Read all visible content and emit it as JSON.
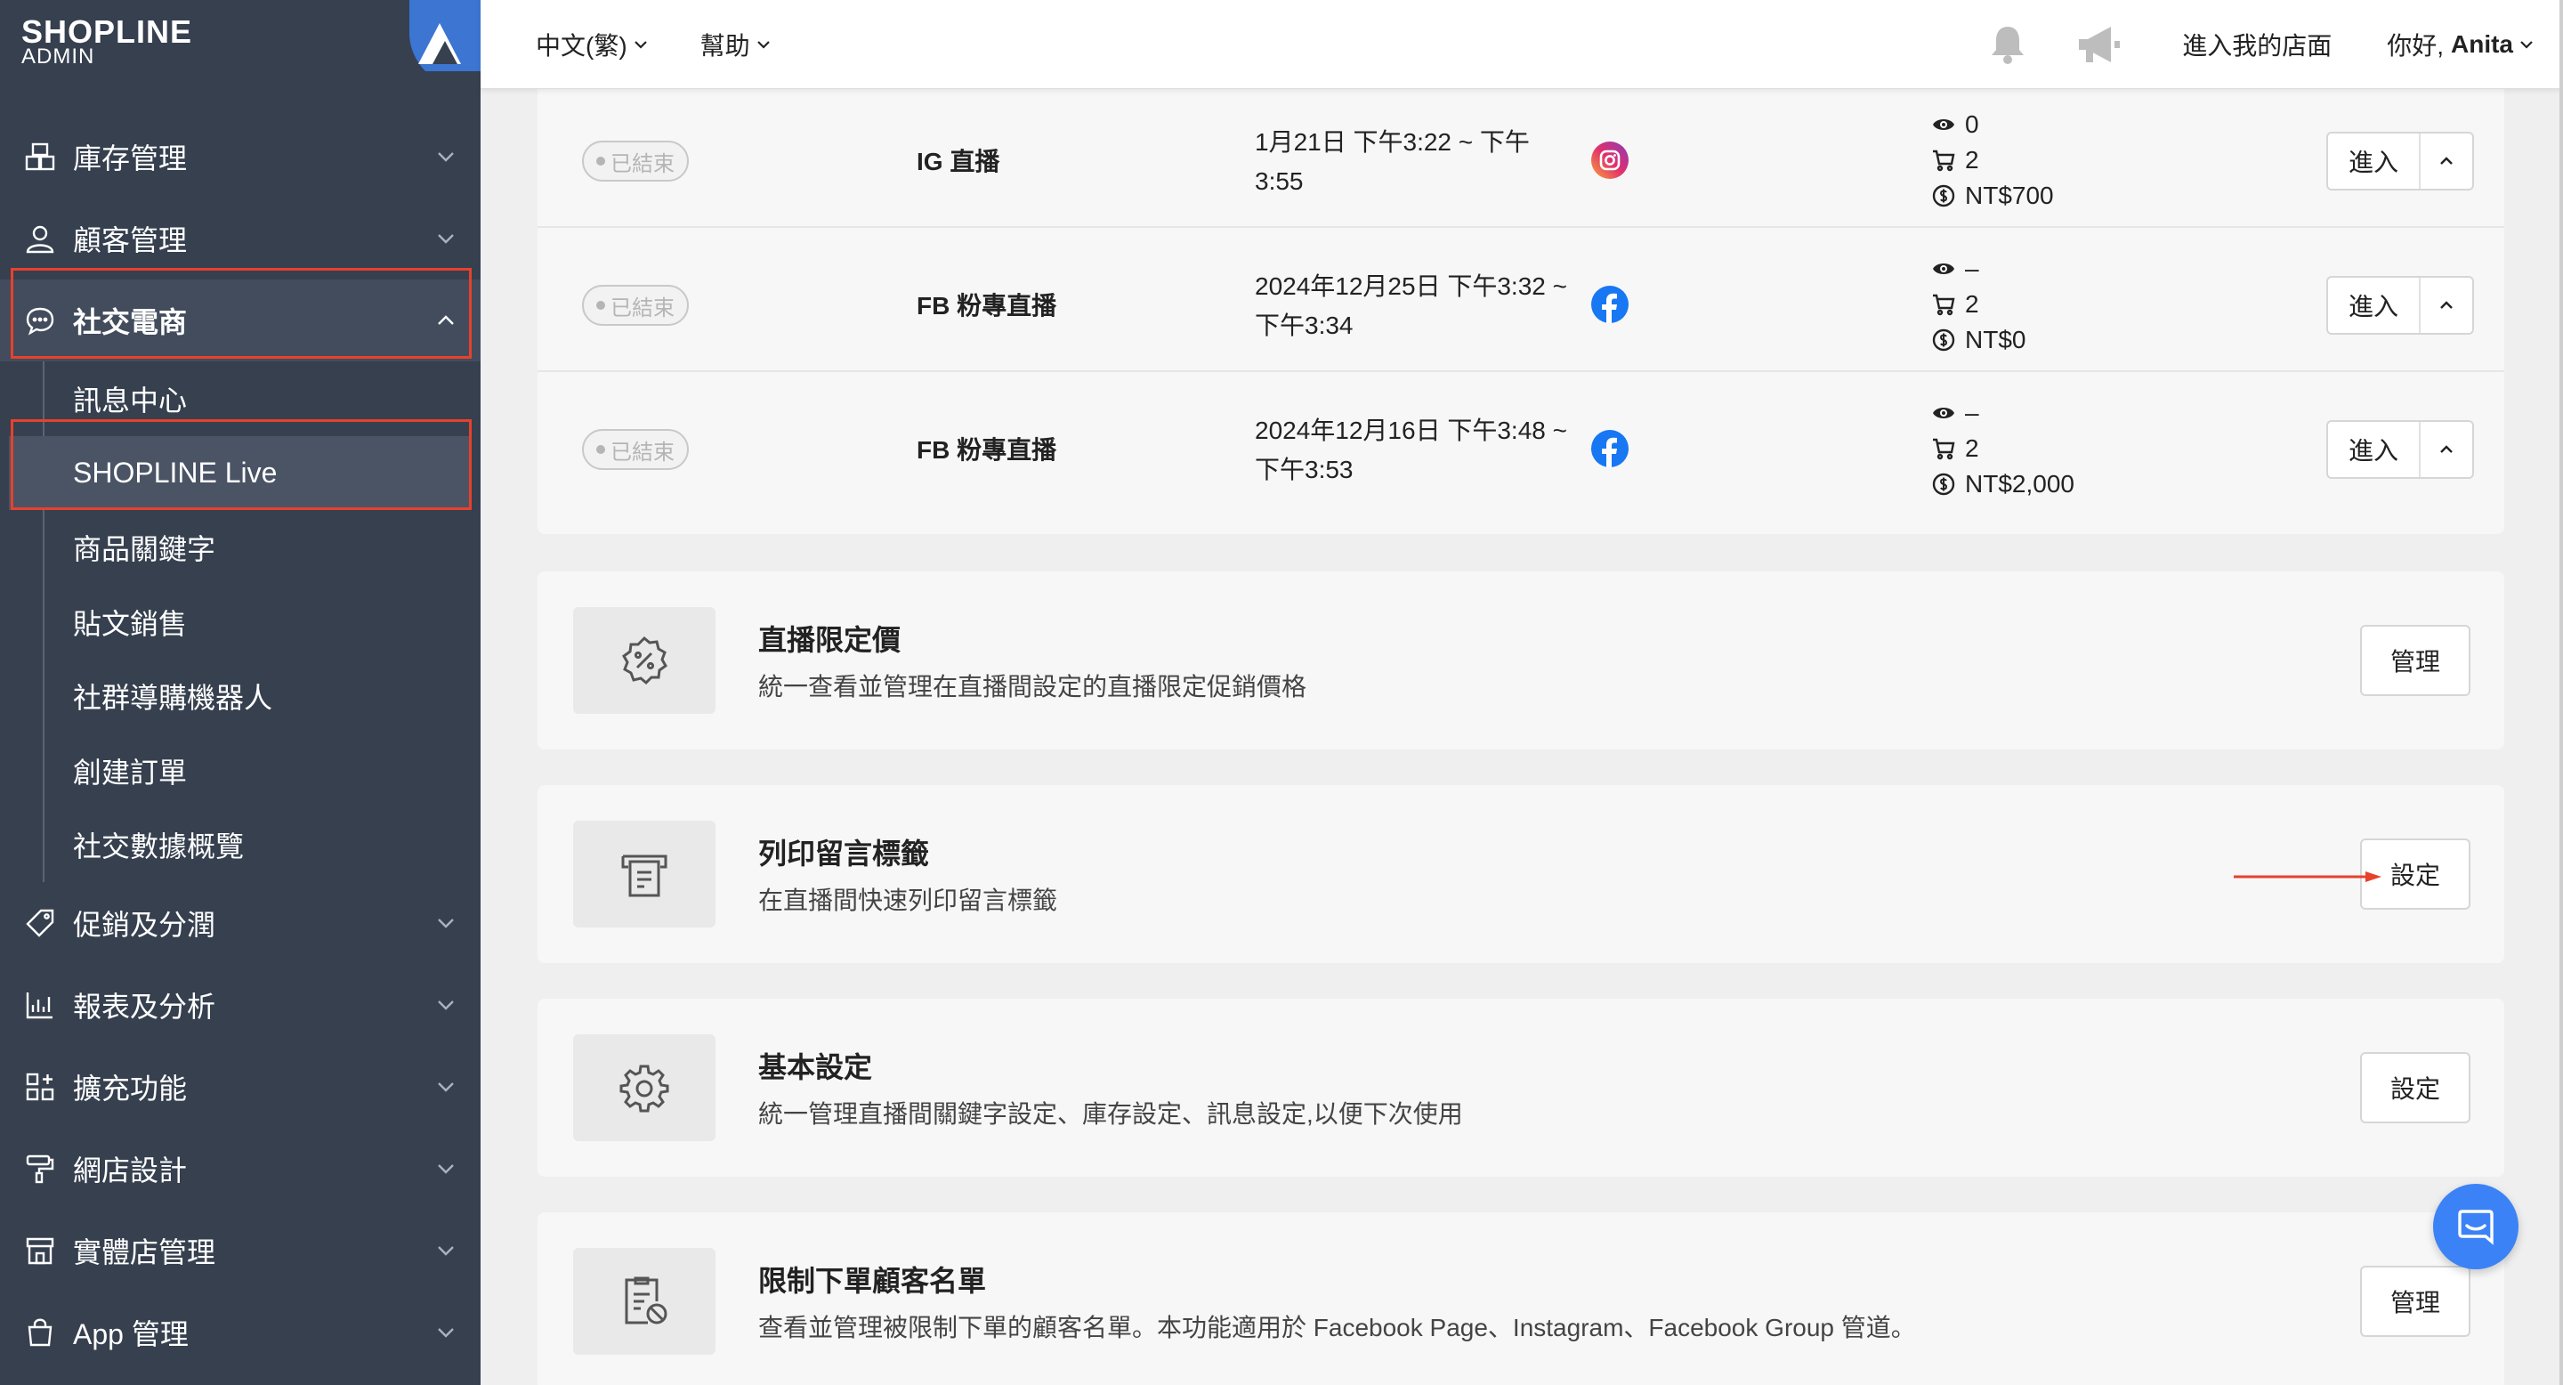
{
  "brand": {
    "logo_main": "SHOPLINE",
    "logo_sub": "ADMIN"
  },
  "sidebar": {
    "items": [
      {
        "label": "庫存管理",
        "icon": "inventory-icon"
      },
      {
        "label": "顧客管理",
        "icon": "user-icon"
      },
      {
        "label": "社交電商",
        "icon": "chat-icon"
      }
    ],
    "sub_items": [
      {
        "label": "訊息中心"
      },
      {
        "label": "SHOPLINE Live"
      },
      {
        "label": "商品關鍵字"
      },
      {
        "label": "貼文銷售"
      },
      {
        "label": "社群導購機器人"
      },
      {
        "label": "創建訂單"
      },
      {
        "label": "社交數據概覽"
      }
    ],
    "lower_items": [
      {
        "label": "促銷及分潤",
        "icon": "tag-icon"
      },
      {
        "label": "報表及分析",
        "icon": "chart-icon"
      },
      {
        "label": "擴充功能",
        "icon": "apps-icon"
      },
      {
        "label": "網店設計",
        "icon": "paint-roller-icon"
      },
      {
        "label": "實體店管理",
        "icon": "store-icon"
      },
      {
        "label": "App 管理",
        "icon": "bag-icon"
      }
    ]
  },
  "topbar": {
    "language": "中文(繁)",
    "help": "幫助",
    "visit_store": "進入我的店面",
    "greeting": "你好,",
    "user_name": "Anita"
  },
  "streams": [
    {
      "status": "已結束",
      "title": "IG 直播",
      "time": "1月21日 下午3:22 ~ 下午3:55",
      "platform": "instagram",
      "views": "0",
      "orders": "2",
      "revenue": "NT$700",
      "enter_label": "進入"
    },
    {
      "status": "已結束",
      "title": "FB 粉專直播",
      "time": "2024年12月25日 下午3:32 ~ 下午3:34",
      "platform": "facebook",
      "views": "–",
      "orders": "2",
      "revenue": "NT$0",
      "enter_label": "進入"
    },
    {
      "status": "已結束",
      "title": "FB 粉專直播",
      "time": "2024年12月16日 下午3:48 ~ 下午3:53",
      "platform": "facebook",
      "views": "–",
      "orders": "2",
      "revenue": "NT$2,000",
      "enter_label": "進入"
    }
  ],
  "features": [
    {
      "title": "直播限定價",
      "desc": "統一查看並管理在直播間設定的直播限定促銷價格",
      "button": "管理",
      "icon": "discount-badge-icon"
    },
    {
      "title": "列印留言標籤",
      "desc": "在直播間快速列印留言標籤",
      "button": "設定",
      "icon": "printer-icon"
    },
    {
      "title": "基本設定",
      "desc": "統一管理直播間關鍵字設定、庫存設定、訊息設定,以便下次使用",
      "button": "設定",
      "icon": "gear-icon"
    },
    {
      "title": "限制下單顧客名單",
      "desc": "查看並管理被限制下單的顧客名單。本功能適用於 Facebook Page、Instagram、Facebook Group 管道。",
      "button": "管理",
      "icon": "blocked-list-icon"
    }
  ],
  "colors": {
    "sidebar_bg": "#36404f",
    "highlight_red": "#e8412c",
    "facebook_blue": "#1877f2",
    "chat_blue": "#3b82f6"
  }
}
